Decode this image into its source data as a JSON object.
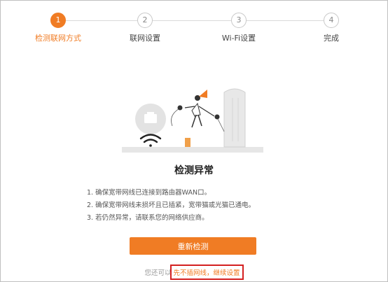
{
  "colors": {
    "accent": "#f07c24",
    "highlight_box": "#d42020",
    "line": "#d9d9d9"
  },
  "steps": [
    {
      "number": "1",
      "label": "检测联网方式",
      "active": true
    },
    {
      "number": "2",
      "label": "联网设置",
      "active": false
    },
    {
      "number": "3",
      "label": "Wi-Fi设置",
      "active": false
    },
    {
      "number": "4",
      "label": "完成",
      "active": false
    }
  ],
  "status": {
    "title": "检测异常"
  },
  "tips": [
    "1. 确保宽带网线已连接到路由器WAN口。",
    "2. 确保宽带网线未损坏且已插紧，宽带猫或光猫已通电。",
    "3. 若仍然异常，请联系您的网络供应商。"
  ],
  "actions": {
    "retry_label": "重新检测",
    "alt_prefix": "您还可以",
    "skip_link": "先不插网线，继续设置"
  },
  "icons": [
    "ethernet-port-icon",
    "wifi-icon"
  ]
}
